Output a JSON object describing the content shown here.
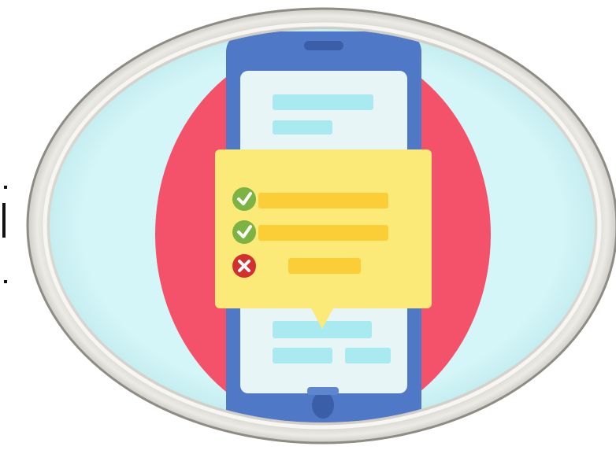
{
  "illustration": {
    "frame_color": "#d9d6cf",
    "backdrop_color": "#d4f6f8",
    "circle_color": "#f4516b",
    "phone_color": "#4f79c6",
    "screen_color": "#e8f5f6",
    "card_color": "#fbe978",
    "bar_color": "#fbcd36",
    "check_color": "#7cb342",
    "cross_color": "#d32f2f",
    "checklist": [
      {
        "state": "checked",
        "icon": "check-icon"
      },
      {
        "state": "checked",
        "icon": "check-icon"
      },
      {
        "state": "unchecked",
        "icon": "cross-icon"
      }
    ]
  }
}
